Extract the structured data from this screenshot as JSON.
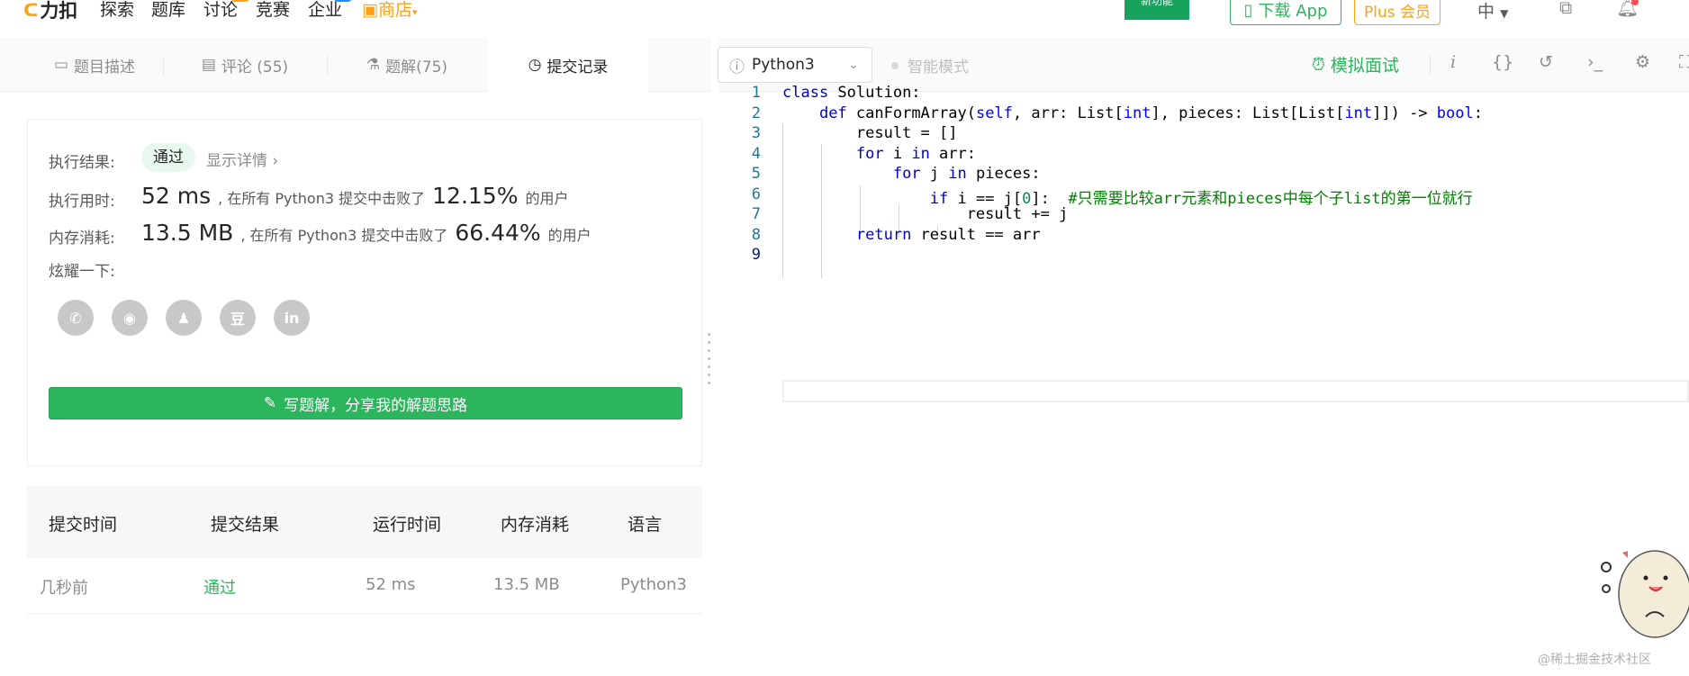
{
  "nav": {
    "logo": "力扣",
    "items": [
      "探索",
      "题库",
      "讨论",
      "竞赛",
      "企业"
    ],
    "store": "商店",
    "new_badge": "新功能",
    "download_app": "下载 App",
    "plus": "Plus 会员",
    "lang": "中"
  },
  "tabs": [
    {
      "label": "题目描述",
      "icon": "description-icon"
    },
    {
      "label": "评论 (55)",
      "icon": "comment-icon"
    },
    {
      "label": "题解(75)",
      "icon": "flask-icon"
    },
    {
      "label": "提交记录",
      "icon": "clock-icon"
    }
  ],
  "result": {
    "exec_label": "执行结果:",
    "status": "通过",
    "details": "显示详情 ›",
    "time_label": "执行用时:",
    "time_value": "52 ms",
    "time_text": ", 在所有 Python3 提交中击败了",
    "time_pct": "12.15%",
    "time_suffix": "的用户",
    "mem_label": "内存消耗:",
    "mem_value": "13.5 MB",
    "mem_text": ", 在所有 Python3 提交中击败了",
    "mem_pct": "66.44%",
    "mem_suffix": "的用户",
    "share_label": "炫耀一下:",
    "share_icons": [
      "wechat-icon",
      "weibo-icon",
      "qq-icon",
      "douban-icon",
      "linkedin-icon"
    ],
    "share_glyphs": [
      "✆",
      "◉",
      "♟",
      "豆",
      "in"
    ],
    "write_btn": "写题解，分享我的解题思路"
  },
  "table": {
    "headers": [
      "提交时间",
      "提交结果",
      "运行时间",
      "内存消耗",
      "语言"
    ],
    "rows": [
      [
        "几秒前",
        "通过",
        "52 ms",
        "13.5 MB",
        "Python3"
      ]
    ]
  },
  "editor": {
    "language": "Python3",
    "smart_mode": "智能模式",
    "mock_interview": "模拟面试",
    "line_numbers": [
      "1",
      "2",
      "3",
      "4",
      "5",
      "6",
      "7",
      "8",
      "9"
    ]
  },
  "watermark": "@稀土掘金技术社区"
}
